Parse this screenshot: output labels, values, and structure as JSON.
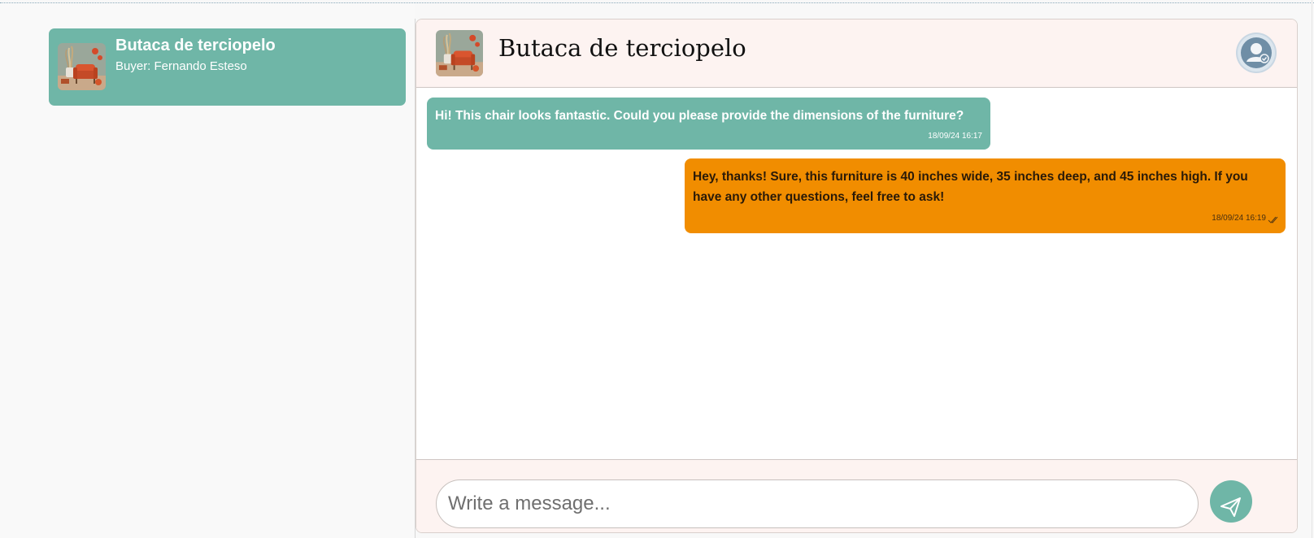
{
  "colors": {
    "accent": "#6fb6a7",
    "outgoing": "#f18d00",
    "header_bg": "#fdf3f1"
  },
  "conversation_list": {
    "items": [
      {
        "title": "Butaca de terciopelo",
        "subtitle": "Buyer: Fernando Esteso",
        "thumbnail_icon": "velvet-armchair-thumbnail"
      }
    ]
  },
  "chat": {
    "header": {
      "title": "Butaca de terciopelo",
      "thumbnail_icon": "velvet-armchair-thumbnail",
      "avatar_icon": "user-verified-avatar-icon"
    },
    "messages": [
      {
        "direction": "incoming",
        "text": "Hi! This chair looks fantastic. Could you please provide the dimensions of the furniture?",
        "time": "18/09/24 16:17"
      },
      {
        "direction": "outgoing",
        "text": "Hey, thanks! Sure, this furniture is 40 inches wide, 35 inches deep, and 45 inches high. If you have any other questions, feel free to ask!",
        "time": "18/09/24 16:19",
        "status_icon": "double-check-icon"
      }
    ],
    "composer": {
      "placeholder": "Write a message...",
      "value": "",
      "send_icon": "send-icon"
    }
  }
}
